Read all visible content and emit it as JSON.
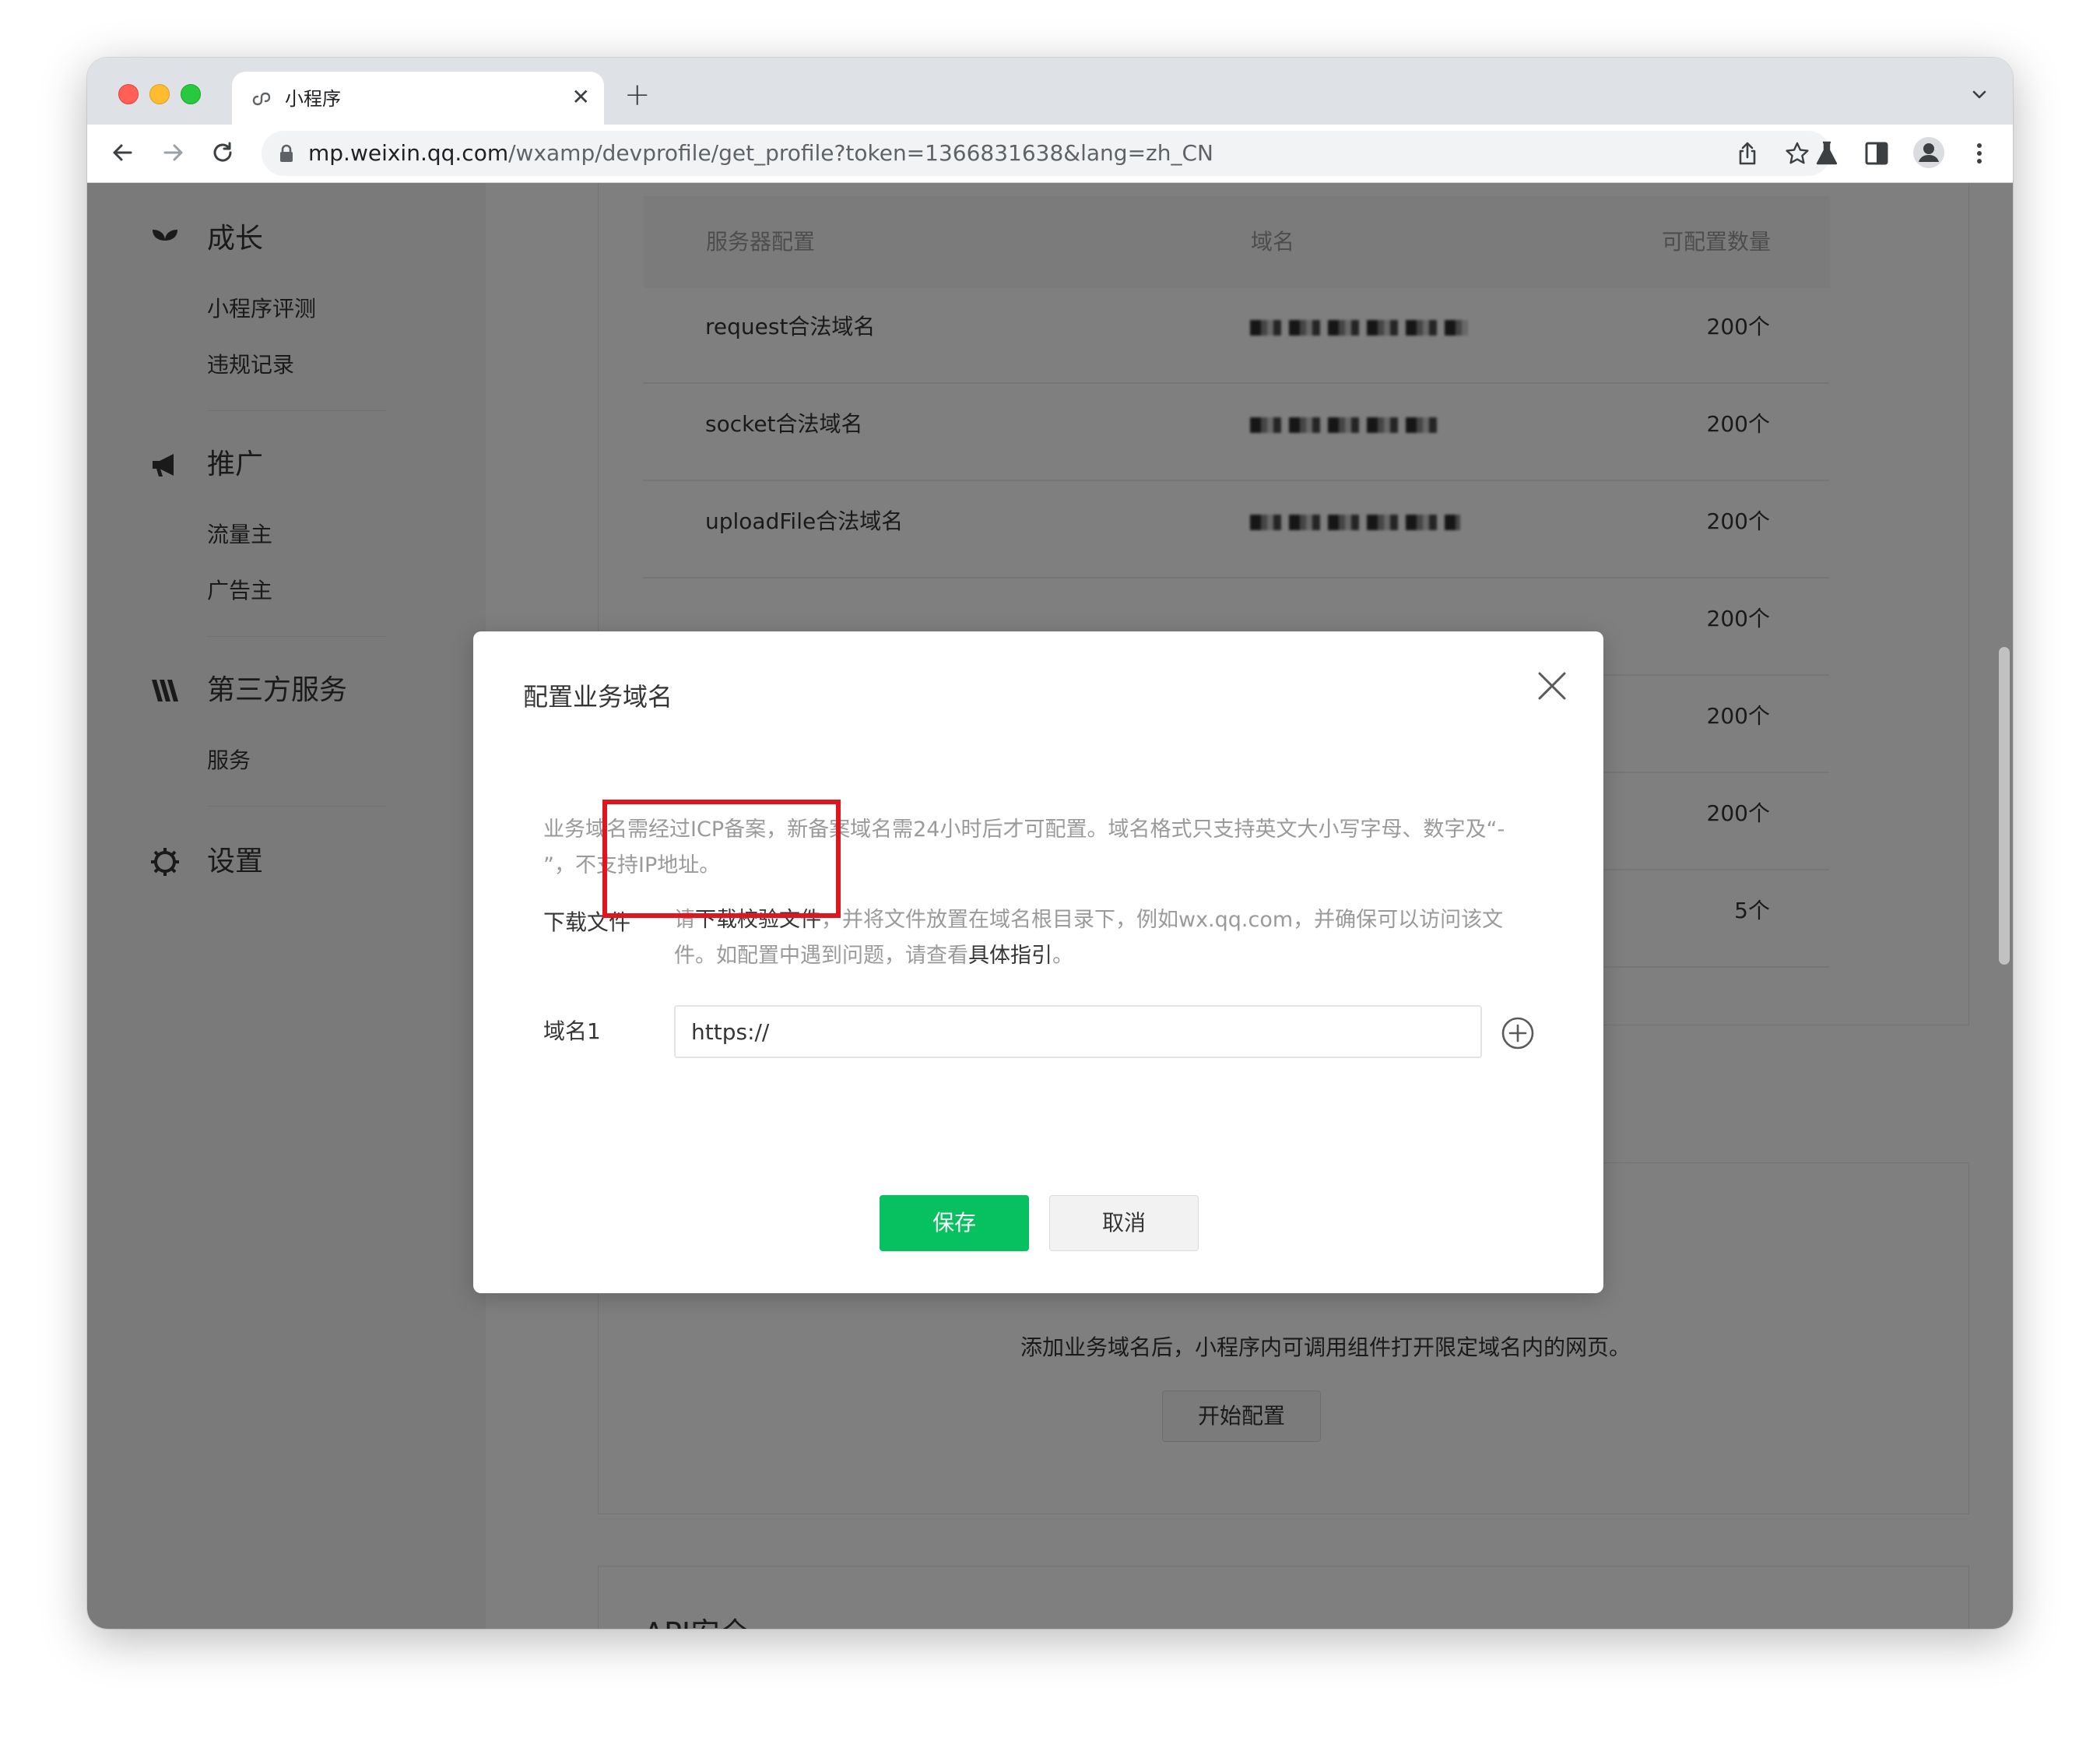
{
  "browser": {
    "tab_title": "小程序",
    "new_tab": "+",
    "url_host": "mp.weixin.qq.com",
    "url_path": "/wxamp/devprofile/get_profile?token=1366831638&lang=zh_CN"
  },
  "sidebar": {
    "groups": [
      {
        "title": "成长",
        "icon": "sprout-icon",
        "items": [
          "小程序评测",
          "违规记录"
        ]
      },
      {
        "title": "推广",
        "icon": "megaphone-icon",
        "items": [
          "流量主",
          "广告主"
        ]
      },
      {
        "title": "第三方服务",
        "icon": "third-party-icon",
        "items": [
          "服务"
        ]
      },
      {
        "title": "设置",
        "icon": "gear-icon",
        "items": []
      }
    ]
  },
  "server_table": {
    "headers": [
      "服务器配置",
      "域名",
      "可配置数量"
    ],
    "rows": [
      {
        "name": "request合法域名",
        "count": "200个"
      },
      {
        "name": "socket合法域名",
        "count": "200个"
      },
      {
        "name": "uploadFile合法域名",
        "count": "200个"
      },
      {
        "name": "",
        "count": "200个"
      },
      {
        "name": "",
        "count": "200个"
      },
      {
        "name": "",
        "count": "200个"
      },
      {
        "name": "",
        "count": "5个"
      }
    ]
  },
  "business_domain": {
    "hint": "添加业务域名后，小程序内可调用组件打开限定域名内的网页。",
    "start_button": "开始配置"
  },
  "api_security": {
    "title": "API安全"
  },
  "dialog": {
    "title": "配置业务域名",
    "description": "业务域名需经过ICP备案，新备案域名需24小时后才可配置。域名格式只支持英文大小写字母、数字及“- ”，不支持IP地址。",
    "download_label": "下载文件",
    "tip_prefix": "请",
    "tip_link": "下载校验文件",
    "tip_middle": "，并将文件放置在域名根目录下，例如wx.qq.com，并确保可以访问该文件。如配置中遇到问题，请查看",
    "tip_link2": "具体指引",
    "tip_suffix": "。",
    "domain_label": "域名1",
    "domain_value": "https://",
    "save_button": "保存",
    "cancel_button": "取消"
  },
  "colors": {
    "accent_green": "#07c160",
    "highlight_red": "#e0161e"
  }
}
